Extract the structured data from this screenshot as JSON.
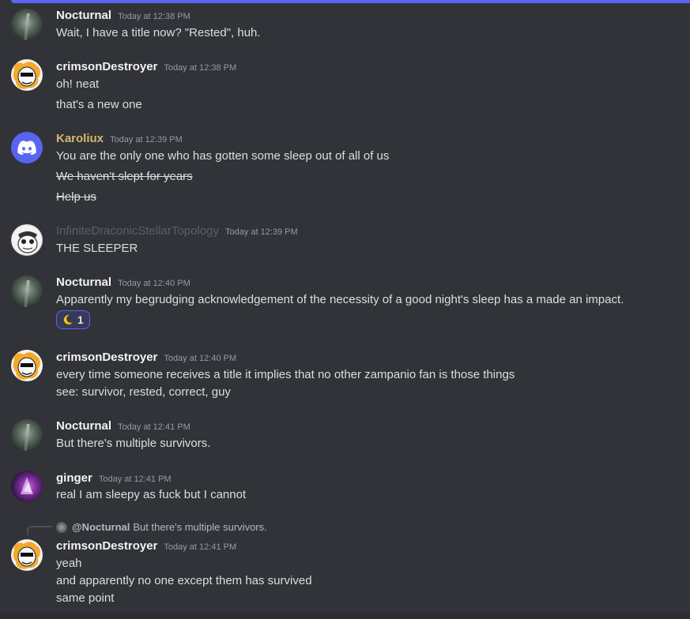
{
  "messages": [
    {
      "author": "Nocturnal",
      "time": "Today at 12:38 PM",
      "lines": [
        "Wait, I have a title now? \"Rested\", huh."
      ],
      "name_color": "#f2f3f5"
    },
    {
      "author": "crimsonDestroyer",
      "time": "Today at 12:38 PM",
      "lines": [
        "oh! neat",
        "that's a new one"
      ],
      "name_color": "#f2f3f5"
    },
    {
      "author": "Karoliux",
      "time": "Today at 12:39 PM",
      "lines": [
        "You are the only one who has gotten some sleep out of all of us",
        "We haven't slept for years",
        "Help us"
      ],
      "name_color": "#d4b86a"
    },
    {
      "author": "InfiniteDraconicStellarTopology",
      "time": "Today at 12:39 PM",
      "lines": [
        "THE SLEEPER"
      ],
      "name_color": "#5c5f66"
    },
    {
      "author": "Nocturnal",
      "time": "Today at 12:40 PM",
      "lines": [
        "Apparently my begrudging acknowledgement of the necessity of a good night's sleep has a made an impact."
      ],
      "name_color": "#f2f3f5",
      "reaction": {
        "emoji": "crescent-moon-icon",
        "count": "1"
      }
    },
    {
      "author": "crimsonDestroyer",
      "time": "Today at 12:40 PM",
      "lines": [
        "every time someone receives a title it implies that no other zampanio fan is those things",
        "see: survivor, rested, correct, guy"
      ],
      "name_color": "#f2f3f5"
    },
    {
      "author": "Nocturnal",
      "time": "Today at 12:41 PM",
      "lines": [
        "But there's multiple survivors."
      ],
      "name_color": "#f2f3f5"
    },
    {
      "author": "ginger",
      "time": "Today at 12:41 PM",
      "lines": [
        "real I am sleepy as fuck but I cannot"
      ],
      "name_color": "#f2f3f5"
    },
    {
      "author": "crimsonDestroyer",
      "time": "Today at 12:41 PM",
      "lines": [
        "yeah",
        "and apparently no one except them has survived",
        "same point"
      ],
      "name_color": "#f2f3f5",
      "reply": {
        "mention": "@Nocturnal",
        "text": "But there's multiple survivors."
      }
    }
  ],
  "colors": {
    "accent": "#5865f2",
    "background": "#313338"
  }
}
